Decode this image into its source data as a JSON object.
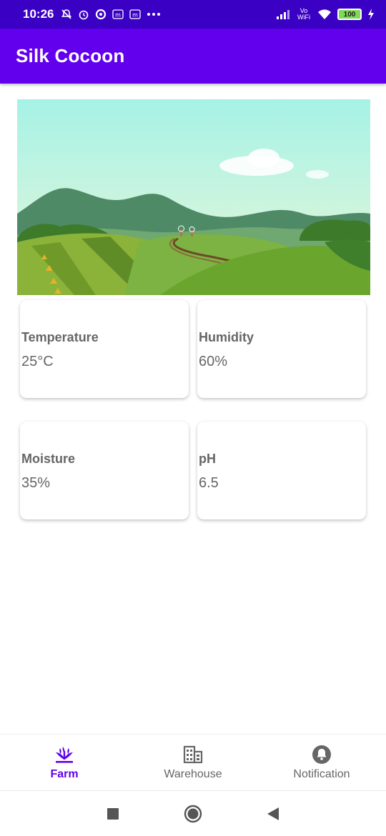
{
  "status_bar": {
    "time": "10:26",
    "left_icons": [
      "bell-off-icon",
      "alarm-icon",
      "data-saver-icon",
      "m-badge-icon",
      "m-badge-icon",
      "more-dots-icon"
    ],
    "right_icons": [
      "signal-icon",
      "vowifi-icon",
      "wifi-icon"
    ],
    "vowifi_text": "Vo WiFi",
    "battery": "100"
  },
  "app_bar": {
    "title": "Silk Cocoon"
  },
  "metrics": [
    {
      "label": "Temperature",
      "value": "25°C"
    },
    {
      "label": "Humidity",
      "value": "60%"
    },
    {
      "label": "Moisture",
      "value": "35%"
    },
    {
      "label": "pH",
      "value": "6.5"
    }
  ],
  "bottom_nav": {
    "items": [
      {
        "label": "Farm",
        "icon": "farm-sprout-icon",
        "active": true
      },
      {
        "label": "Warehouse",
        "icon": "warehouse-building-icon",
        "active": false
      },
      {
        "label": "Notification",
        "icon": "bell-icon",
        "active": false
      }
    ]
  },
  "system_nav": [
    "recents-square-icon",
    "home-circle-icon",
    "back-triangle-icon"
  ],
  "colors": {
    "status_bar": "#3a00c4",
    "app_bar": "#6200ee",
    "accent": "#6200ee",
    "label_text": "#666666"
  }
}
